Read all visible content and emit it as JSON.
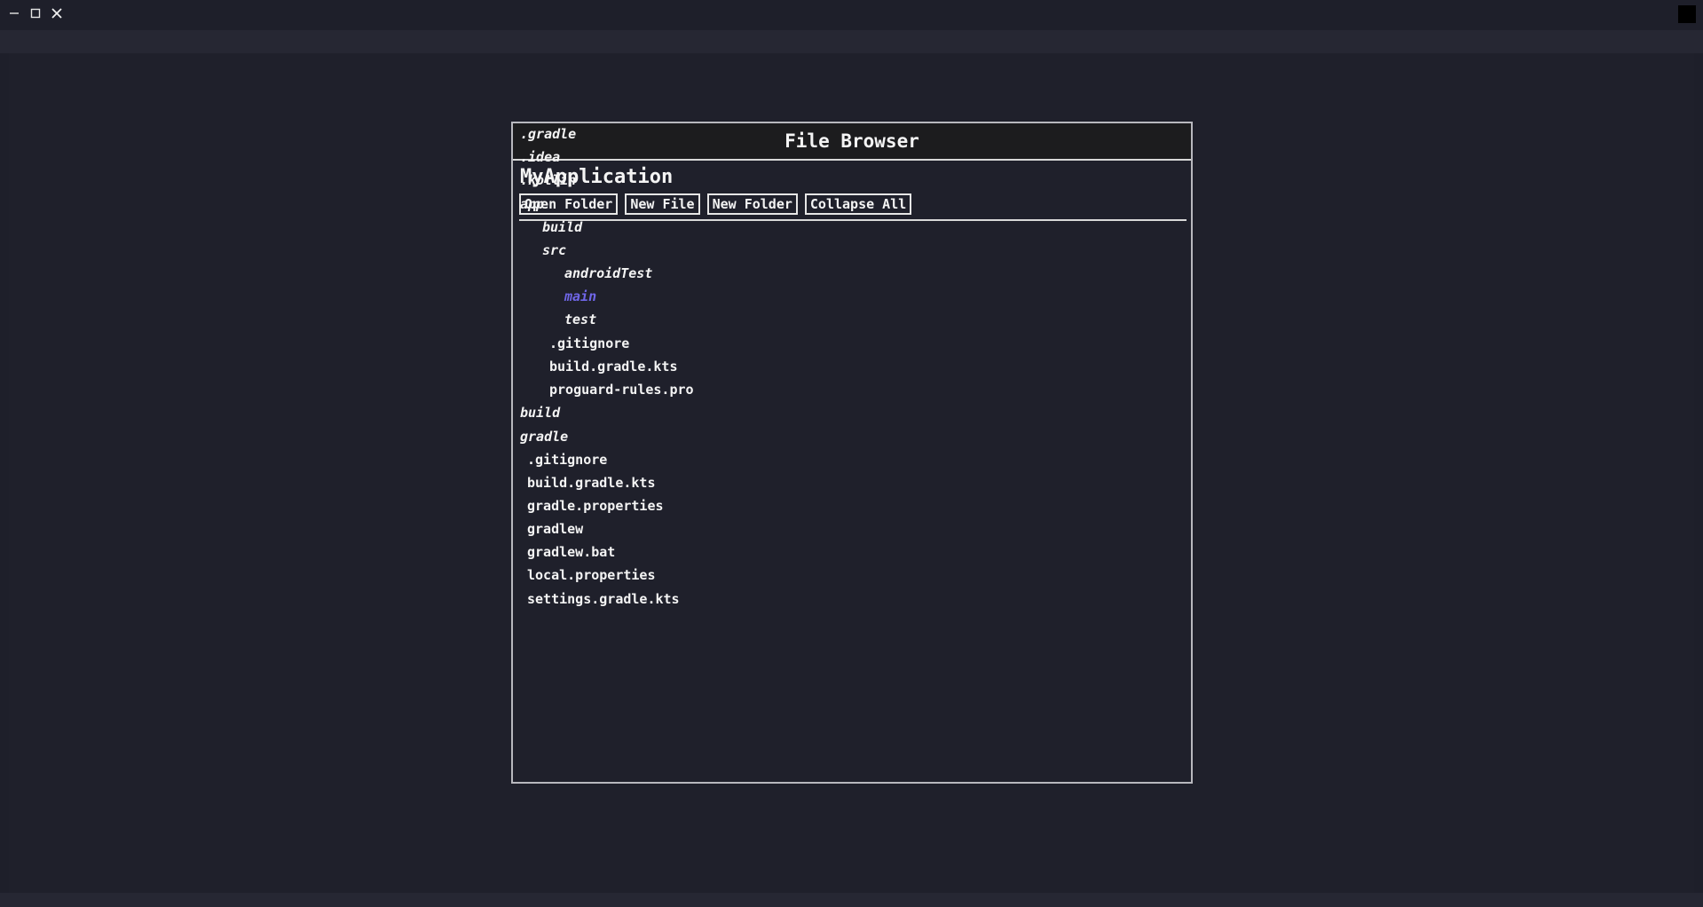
{
  "window": {
    "controls": {
      "minimize_icon": "minimize-icon",
      "maximize_icon": "maximize-icon",
      "close_icon": "close-icon"
    }
  },
  "panel": {
    "title": "File Browser",
    "project_name": "MyApplication",
    "toolbar": {
      "open_folder": "Open Folder",
      "new_file": "New File",
      "new_folder": "New Folder",
      "collapse_all": "Collapse All"
    }
  },
  "tree": [
    {
      "label": ".gradle",
      "kind": "folder"
    },
    {
      "label": ".idea",
      "kind": "folder"
    },
    {
      "label": ".kotlin",
      "kind": "folder"
    },
    {
      "label": "app",
      "kind": "folder"
    },
    {
      "label": "build",
      "kind": "folder"
    },
    {
      "label": "src",
      "kind": "folder"
    },
    {
      "label": "androidTest",
      "kind": "folder"
    },
    {
      "label": "main",
      "kind": "folder",
      "selected": true
    },
    {
      "label": "test",
      "kind": "folder"
    },
    {
      "label": ".gitignore",
      "kind": "file"
    },
    {
      "label": "build.gradle.kts",
      "kind": "file"
    },
    {
      "label": "proguard-rules.pro",
      "kind": "file"
    },
    {
      "label": "build",
      "kind": "folder"
    },
    {
      "label": "gradle",
      "kind": "folder"
    },
    {
      "label": ".gitignore",
      "kind": "file"
    },
    {
      "label": "build.gradle.kts",
      "kind": "file"
    },
    {
      "label": "gradle.properties",
      "kind": "file"
    },
    {
      "label": "gradlew",
      "kind": "file"
    },
    {
      "label": "gradlew.bat",
      "kind": "file"
    },
    {
      "label": "local.properties",
      "kind": "file"
    },
    {
      "label": "settings.gradle.kts",
      "kind": "file"
    }
  ],
  "colors": {
    "background": "#1e1f2a",
    "panel_header": "#1c1c1e",
    "text": "#f4f4f4",
    "selected": "#6f66e8",
    "border": "#d8d8d8"
  }
}
